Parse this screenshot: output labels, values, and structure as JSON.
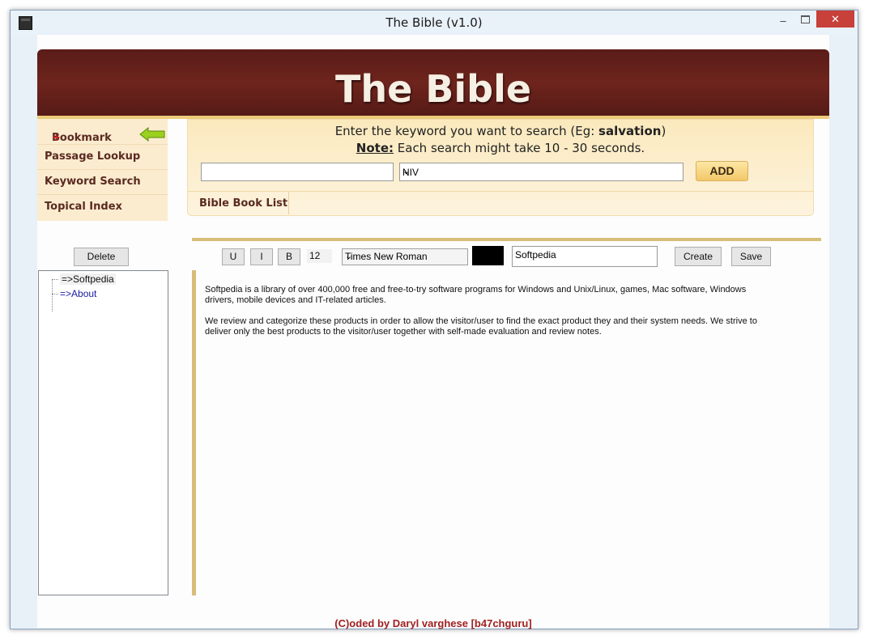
{
  "window": {
    "title": "The Bible (v1.0)",
    "min_glyph": "–",
    "close_glyph": "✕"
  },
  "header": {
    "title": "The Bible"
  },
  "nav": {
    "items": [
      {
        "label": "Bookmark",
        "badge": "+"
      },
      {
        "label": "Passage Lookup"
      },
      {
        "label": "Keyword Search"
      },
      {
        "label": "Topical Index"
      }
    ]
  },
  "search": {
    "prompt_prefix": "Enter the keyword you want to search (Eg: ",
    "prompt_example": "salvation",
    "prompt_suffix": ")",
    "note_label": "Note:",
    "note_text": " Each search might take 10 - 30 seconds.",
    "keyword_value": "",
    "version_value": "NIV",
    "add_label": "ADD",
    "book_list_tab": "Bible Book List"
  },
  "sidebar": {
    "delete_label": "Delete",
    "tree": [
      {
        "label": "=>Softpedia"
      },
      {
        "label": "=>About"
      }
    ]
  },
  "editor": {
    "underline_label": "U",
    "italic_label": "I",
    "bold_label": "B",
    "font_size": "12",
    "font_name": "Times New Roman",
    "text_color": "#000000",
    "title_value": "Softpedia",
    "create_label": "Create",
    "save_label": "Save",
    "paragraphs": [
      "Softpedia is a library of over 400,000 free and free-to-try software programs for Windows and Unix/Linux, games, Mac software, Windows drivers, mobile devices and IT-related articles.",
      "We review and categorize these products in order to allow the visitor/user to find the exact product they and their system needs. We strive to deliver only the best products to the visitor/user together with self-made evaluation and review notes."
    ]
  },
  "footer": {
    "credit": "(C)oded by Daryl varghese [b47chguru]"
  },
  "colors": {
    "header_bg": "#6e241d",
    "panel_bg": "#fbeccf",
    "accent": "#d7bd78",
    "footer_text": "#a02020"
  }
}
